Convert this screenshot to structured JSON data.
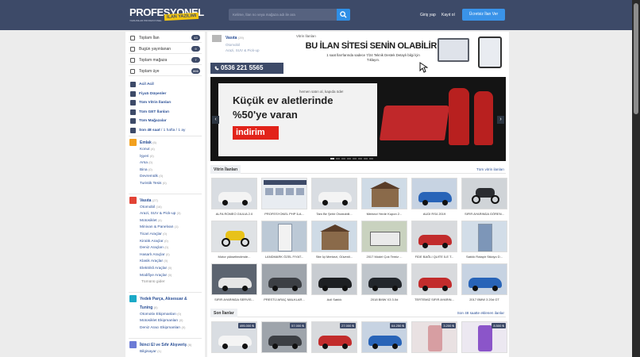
{
  "header": {
    "logo_text": "PROFESYONEL",
    "logo_badge": "İLAN YAZILIMI",
    "logo_tagline": "YAZILIMLAR PROFESYONEL",
    "search_placeholder": "Kelime, İlan no veya mağaza adı ile ara",
    "login_label": "Giriş yap",
    "register_label": "Kayıt ol",
    "cta_label": "Ücretsiz İlan Ver"
  },
  "sidebar": {
    "stats": [
      {
        "label": "Toplam İlan",
        "count": "43"
      },
      {
        "label": "Bugün yayınlanan",
        "count": "9"
      },
      {
        "label": "Toplam mağaza",
        "count": "7"
      },
      {
        "label": "Toplam üye",
        "count": "866"
      }
    ],
    "quick": [
      {
        "label": "Acil Acil"
      },
      {
        "label": "Fiyatı Düşenler"
      },
      {
        "label": "Tüm Vitrin İlanları"
      },
      {
        "label": "Tüm GET İlanları"
      },
      {
        "label": "Tüm Mağazalar"
      },
      {
        "label": "Son 48 saat",
        "extra": " / 1 hafta / 1 ay"
      }
    ],
    "categories": [
      {
        "label": "Emlak",
        "count": "(6)",
        "color": "#f2a01e",
        "items": [
          {
            "label": "Konut",
            "count": "(4)"
          },
          {
            "label": "İşyeri",
            "count": "(0)"
          },
          {
            "label": "Arsa",
            "count": "(0)"
          },
          {
            "label": "Bina",
            "count": "(0)"
          },
          {
            "label": "Devremülk",
            "count": "(0)"
          },
          {
            "label": "Turistik Tesis",
            "count": "(0)"
          }
        ]
      },
      {
        "label": "Vasıta",
        "count": "(27)",
        "color": "#e24335",
        "items": [
          {
            "label": "Otomobil",
            "count": "(16)"
          },
          {
            "label": "Arazi, SUV & Pick-up",
            "count": "(3)"
          },
          {
            "label": "Motosiklet",
            "count": "(4)"
          },
          {
            "label": "Minivan & Panelvan",
            "count": "(1)"
          },
          {
            "label": "Ticari Araçlar",
            "count": "(0)"
          },
          {
            "label": "Kiralık Araçlar",
            "count": "(0)"
          },
          {
            "label": "Deniz Araçları",
            "count": "(0)"
          },
          {
            "label": "Hasarlı Araçlar",
            "count": "(0)"
          },
          {
            "label": "Klasik Araçlar",
            "count": "(0)"
          },
          {
            "label": "Elektrikli Araçlar",
            "count": "(0)"
          },
          {
            "label": "Modifiye Araçlar",
            "count": "(0)"
          },
          {
            "label": "Tümünü gider",
            "count": ""
          }
        ]
      },
      {
        "label": "Yedek Parça, Aksesuar &",
        "label2": "Tuning",
        "count": "(0)",
        "color": "#1ba9c7",
        "items": [
          {
            "label": "Otomotiv Ekipmanları",
            "count": "(0)"
          },
          {
            "label": "Motosiklet Ekipmanları",
            "count": "(0)"
          },
          {
            "label": "Deniz Aracı Ekipmanları",
            "count": "(0)"
          }
        ]
      },
      {
        "label": "İkinci El ve Sıfır Alışveriş",
        "count": "(6)",
        "color": "#6c7bd6",
        "items": [
          {
            "label": "Bilgisayar",
            "count": "(1)"
          }
        ]
      }
    ]
  },
  "featured_listing": {
    "title": "Vasıta",
    "count": "(29)",
    "lines": [
      "Otomobil",
      "Arazi, SUV & Pick-up"
    ],
    "phone": "0536 221 5565"
  },
  "ad_banner": {
    "kicker": "Vitrin İlanları",
    "title": "BU İLAN SİTESİ SENİN OLABİLİR!",
    "sub": "1 saat İlan'larında sadece 7/24 Teknik Destek Detaylı bilgi İçin Tıklayın."
  },
  "slider": {
    "kicker": "hemen satın al, kapıda öde!",
    "headline1": "Küçük ev aletlerinde",
    "headline2": "%50'ye varan",
    "badge": "indirim",
    "prev_icon": "‹",
    "next_icon": "›"
  },
  "showcase": {
    "tab_label": "Vitrin İlanları",
    "link_label": "Tüm vitrin ilanları",
    "rows": [
      [
        {
          "caption": "ALFA ROMEO GIULIA 2.0",
          "thumb": "car-white"
        },
        {
          "caption": "PROFESYONEL PHP İLA...",
          "thumb": "screenshot"
        },
        {
          "caption": "Tam Bir Şehir Otomobili...",
          "thumb": "car-white"
        },
        {
          "caption": "Merkezi Yerde Kupon 2...",
          "thumb": "house"
        },
        {
          "caption": "AUDI RS4 2019",
          "thumb": "car-blue"
        },
        {
          "caption": "SIFIR AYARINDA GÖREN...",
          "thumb": "motorbike"
        }
      ],
      [
        {
          "caption": "Motor yükseltecilmde...",
          "thumb": "motorbike-yellow"
        },
        {
          "caption": "LANDMARK ÖZEL FIYAT...",
          "thumb": "building"
        },
        {
          "caption": "Site İçi Merkezi, Güvenli...",
          "thumb": "house"
        },
        {
          "caption": "2017 Model Çok Temiz ...",
          "thumb": "truck"
        },
        {
          "caption": "FİDE BAĞLI QUITE İLE T...",
          "thumb": "car-red"
        },
        {
          "caption": "Satılık Rotapir Stüdyo D...",
          "thumb": "tower"
        }
      ],
      [
        {
          "caption": "SIFIR AYARINDA SERVİS...",
          "thumb": "car-dark"
        },
        {
          "caption": "PRESTİJ ARAÇ MALKLAR...",
          "thumb": "car-grey"
        },
        {
          "caption": "Acil Satılık",
          "thumb": "car-black"
        },
        {
          "caption": "2018 BMW X3 3.0d",
          "thumb": "suv-black"
        },
        {
          "caption": "TERTEMİZ SIFIR AYARIN...",
          "thumb": "car-red"
        },
        {
          "caption": "2017 BMW 3 20d GT",
          "thumb": "car-blue"
        }
      ]
    ]
  },
  "latest": {
    "tab_label": "Son İlanlar",
    "link_label": "Son 48 saatte eklenen ilanlar",
    "items": [
      {
        "price": "495.000 ₺",
        "thumb": "car-white"
      },
      {
        "price": "57.000 ₺",
        "thumb": "car-grey"
      },
      {
        "price": "27.000 ₺",
        "thumb": "car-red"
      },
      {
        "price": "64.250 ₺",
        "thumb": "car-blue"
      },
      {
        "price": "3.200 ₺",
        "thumb": "phone-rose"
      },
      {
        "price": "8.500 ₺",
        "thumb": "phone-purple"
      }
    ]
  },
  "colors": {
    "header_bg": "#3d4a68",
    "accent_blue": "#3a93e8",
    "link": "#2a4f96",
    "promo_red": "#e2231a"
  }
}
